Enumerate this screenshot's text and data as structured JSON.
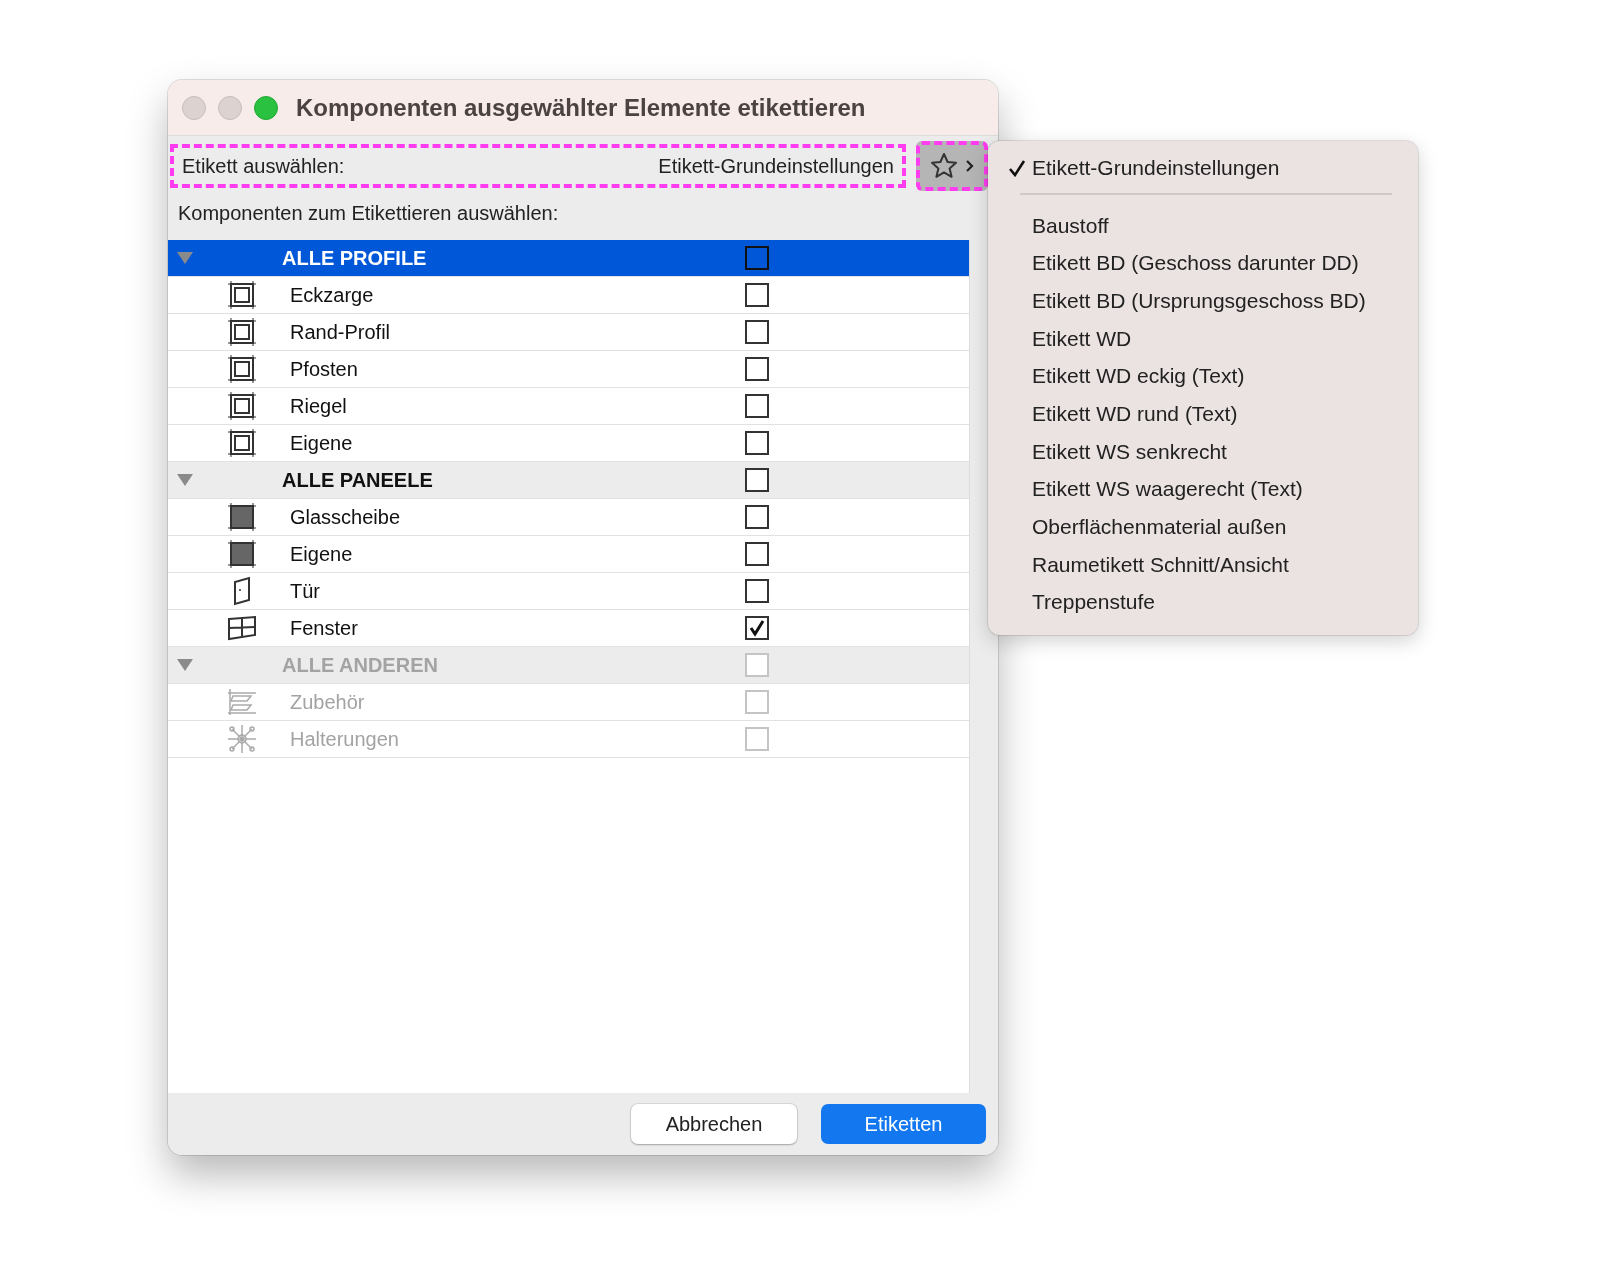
{
  "window": {
    "title": "Komponenten ausgewählter Elemente etikettieren"
  },
  "label_select": {
    "label": "Etikett auswählen:",
    "value": "Etikett-Grundeinstellungen",
    "highlighted": true
  },
  "favorites_button": {
    "highlighted": true
  },
  "instruction": "Komponenten zum Etikettieren auswählen:",
  "tree": [
    {
      "label": "ALLE PROFILE",
      "expanded": true,
      "selected": true,
      "checked": false,
      "disabled": false,
      "children": [
        {
          "label": "Eckzarge",
          "kind": "frame",
          "selected": false,
          "checked": false,
          "disabled": false
        },
        {
          "label": "Rand-Profil",
          "kind": "frame",
          "selected": false,
          "checked": false,
          "disabled": false
        },
        {
          "label": "Pfosten",
          "kind": "frame",
          "selected": false,
          "checked": false,
          "disabled": false
        },
        {
          "label": "Riegel",
          "kind": "frame",
          "selected": false,
          "checked": false,
          "disabled": false
        },
        {
          "label": "Eigene",
          "kind": "frame",
          "selected": false,
          "checked": false,
          "disabled": false
        }
      ]
    },
    {
      "label": "ALLE PANEELE",
      "expanded": true,
      "selected": false,
      "checked": false,
      "disabled": false,
      "children": [
        {
          "label": "Glasscheibe",
          "kind": "panel",
          "selected": false,
          "checked": false,
          "disabled": false
        },
        {
          "label": "Eigene",
          "kind": "panel",
          "selected": false,
          "checked": false,
          "disabled": false
        },
        {
          "label": "Tür",
          "kind": "door",
          "selected": false,
          "checked": false,
          "disabled": false
        },
        {
          "label": "Fenster",
          "kind": "window",
          "selected": false,
          "checked": true,
          "disabled": false
        }
      ]
    },
    {
      "label": "ALLE ANDEREN",
      "expanded": true,
      "selected": false,
      "checked": false,
      "disabled": true,
      "children": [
        {
          "label": "Zubehör",
          "kind": "accessory",
          "selected": false,
          "checked": false,
          "disabled": true
        },
        {
          "label": "Halterungen",
          "kind": "bracket",
          "selected": false,
          "checked": false,
          "disabled": true
        }
      ]
    }
  ],
  "buttons": [
    {
      "label": "Abbrechen",
      "kind": "secondary"
    },
    {
      "label": "Etiketten",
      "kind": "primary"
    }
  ],
  "menu": {
    "items": [
      {
        "kind": "item",
        "label": "Etikett-Grundeinstellungen",
        "checked": true
      },
      {
        "kind": "separator"
      },
      {
        "kind": "item",
        "label": "Baustoff",
        "checked": false
      },
      {
        "kind": "item",
        "label": "Etikett BD (Geschoss darunter DD)",
        "checked": false
      },
      {
        "kind": "item",
        "label": "Etikett BD (Ursprungsgeschoss BD)",
        "checked": false
      },
      {
        "kind": "item",
        "label": "Etikett WD",
        "checked": false
      },
      {
        "kind": "item",
        "label": "Etikett WD eckig (Text)",
        "checked": false
      },
      {
        "kind": "item",
        "label": "Etikett WD rund (Text)",
        "checked": false
      },
      {
        "kind": "item",
        "label": "Etikett WS senkrecht",
        "checked": false
      },
      {
        "kind": "item",
        "label": "Etikett WS waagerecht (Text)",
        "checked": false
      },
      {
        "kind": "item",
        "label": "Oberflächenmaterial außen",
        "checked": false
      },
      {
        "kind": "item",
        "label": "Raumetikett Schnitt/Ansicht",
        "checked": false
      },
      {
        "kind": "item",
        "label": "Treppenstufe",
        "checked": false
      }
    ]
  }
}
